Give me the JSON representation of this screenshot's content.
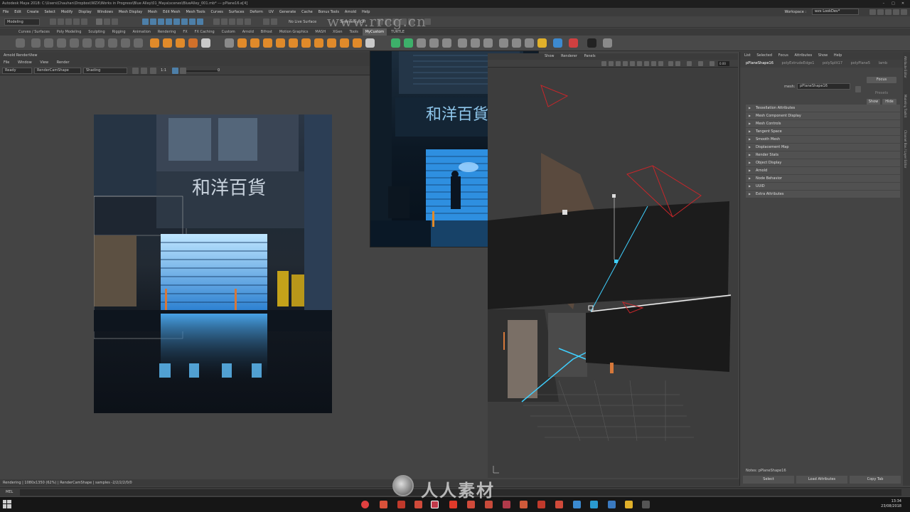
{
  "title_bar": {
    "title": "Autodesk Maya 2018: C:\\Users\\Chauhan\\Dropbox\\WZX\\Works in Progress\\Blue Alley\\01_Maya\\scenes\\BlueAlley_001.mb* --- pPlane16.e[4]",
    "minimize": "–",
    "maximize": "□",
    "close": "✕"
  },
  "menubar": {
    "items": [
      "File",
      "Edit",
      "Create",
      "Select",
      "Modify",
      "Display",
      "Windows",
      "Mesh Display",
      "Mesh",
      "Edit Mesh",
      "Mesh Tools",
      "Curves",
      "Surfaces",
      "Deform",
      "UV",
      "Generate",
      "Cache",
      "Bonus Tools",
      "Arnold",
      "Help"
    ],
    "workspace_label": "Workspace :",
    "workspace_value": "wzx LookDev*"
  },
  "status_line": {
    "mode": "Modeling",
    "live_surface": "No Live Surface",
    "symmetry": "Symmetry: Off"
  },
  "shelf_tabs": {
    "items": [
      "Curves / Surfaces",
      "Poly Modeling",
      "Sculpting",
      "Rigging",
      "Animation",
      "Rendering",
      "FX",
      "FX Caching",
      "Custom",
      "Arnold",
      "Bifrost",
      "Motion Graphics",
      "MASH",
      "XGen",
      "Tools",
      "MyCustom",
      "TURTLE"
    ],
    "active": "MyCustom"
  },
  "render_view": {
    "title": "Arnold RenderView",
    "menu": [
      "File",
      "Window",
      "View",
      "Render"
    ],
    "status": "Ready",
    "camera": "RenderCamShape",
    "channel": "Shading",
    "ratio": "1:1",
    "exposure": "0",
    "render_sign": "和洋百貨"
  },
  "reference_image": {
    "sign": "和洋百貨"
  },
  "viewport": {
    "menu": [
      "Show",
      "Renderer",
      "Panels"
    ],
    "field_value": "0.00"
  },
  "attribute_editor": {
    "menu": [
      "List",
      "Selected",
      "Focus",
      "Attributes",
      "Show",
      "Help"
    ],
    "tabs": [
      "pPlaneShape16",
      "polyExtrudeEdge1",
      "polySplit17",
      "polyPlane5",
      "lamb"
    ],
    "active_tab": "pPlaneShape16",
    "mesh_label": "mesh:",
    "mesh_value": "pPlaneShape16",
    "focus_button": "Focus",
    "presets_label": "Presets",
    "show_button": "Show",
    "hide_button": "Hide",
    "sections": [
      "Tessellation Attributes",
      "Mesh Component Display",
      "Mesh Controls",
      "Tangent Space",
      "Smooth Mesh",
      "Displacement Map",
      "Render Stats",
      "Object Display",
      "Arnold",
      "Node Behavior",
      "UUID",
      "Extra Attributes"
    ],
    "notes": "Notes:  pPlaneShape16",
    "select_button": "Select",
    "load_attributes_button": "Load Attributes",
    "copy_tab_button": "Copy Tab"
  },
  "side_strip": {
    "tabs": [
      "Attribute Editor",
      "Modeling Toolkit",
      "Channel Box / Layer Editor"
    ]
  },
  "help_line": "Rendering | 1080x1350 (62%) | RenderCamShape | samples -2/2/2/2/0/0",
  "command_line": {
    "language": "MEL"
  },
  "taskbar": {
    "time": "13:34",
    "date": "23/08/2018"
  },
  "watermark": {
    "site": "www.rrcg.cn",
    "brand": "人人素材"
  },
  "colors": {
    "accent_blue": "#4aa8ff",
    "selection_white": "#f2f2f2",
    "camera_red": "#c8262a",
    "path_cyan": "#3fd0ff"
  }
}
